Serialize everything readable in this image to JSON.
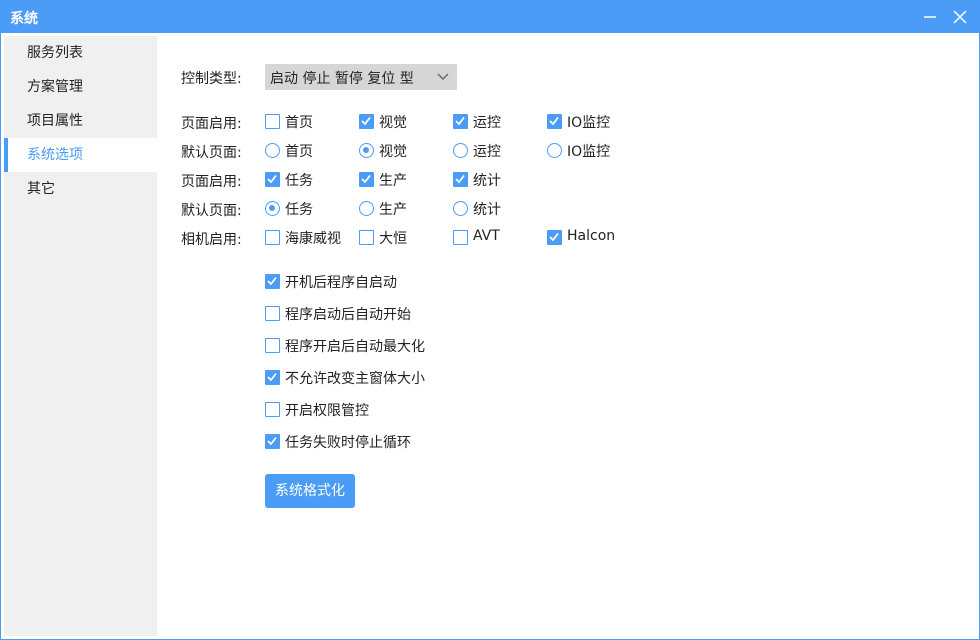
{
  "window": {
    "title": "系统"
  },
  "sidebar": {
    "items": [
      {
        "label": "服务列表",
        "active": false
      },
      {
        "label": "方案管理",
        "active": false
      },
      {
        "label": "项目属性",
        "active": false
      },
      {
        "label": "系统选项",
        "active": true
      },
      {
        "label": "其它",
        "active": false
      }
    ]
  },
  "control": {
    "label": "控制类型:",
    "value": "启动 停止 暂停 复位 型"
  },
  "rows": [
    {
      "label": "页面启用:",
      "type": "checkbox",
      "options": [
        {
          "label": "首页",
          "checked": false
        },
        {
          "label": "视觉",
          "checked": true
        },
        {
          "label": "运控",
          "checked": true
        },
        {
          "label": "IO监控",
          "checked": true
        }
      ]
    },
    {
      "label": "默认页面:",
      "type": "radio",
      "options": [
        {
          "label": "首页",
          "checked": false
        },
        {
          "label": "视觉",
          "checked": true
        },
        {
          "label": "运控",
          "checked": false
        },
        {
          "label": "IO监控",
          "checked": false
        }
      ]
    },
    {
      "label": "页面启用:",
      "type": "checkbox",
      "options": [
        {
          "label": "任务",
          "checked": true
        },
        {
          "label": "生产",
          "checked": true
        },
        {
          "label": "统计",
          "checked": true
        }
      ]
    },
    {
      "label": "默认页面:",
      "type": "radio",
      "options": [
        {
          "label": "任务",
          "checked": true
        },
        {
          "label": "生产",
          "checked": false
        },
        {
          "label": "统计",
          "checked": false
        }
      ]
    },
    {
      "label": "相机启用:",
      "type": "checkbox",
      "options": [
        {
          "label": "海康威视",
          "checked": false
        },
        {
          "label": "大恒",
          "checked": false
        },
        {
          "label": "AVT",
          "checked": false
        },
        {
          "label": "Halcon",
          "checked": true
        }
      ]
    }
  ],
  "options": [
    {
      "label": "开机后程序自启动",
      "checked": true
    },
    {
      "label": "程序启动后自动开始",
      "checked": false
    },
    {
      "label": "程序开启后自动最大化",
      "checked": false
    },
    {
      "label": "不允许改变主窗体大小",
      "checked": true
    },
    {
      "label": "开启权限管控",
      "checked": false
    },
    {
      "label": "任务失败时停止循环",
      "checked": true
    }
  ],
  "format_button": {
    "label": "系统格式化"
  },
  "colors": {
    "accent": "#4a9cf6",
    "sidebar_bg": "#f0f0f0",
    "select_bg": "#d6d6d6"
  },
  "icons": {
    "minimize": "minimize-icon",
    "close": "close-icon",
    "dropdown": "chevron-down-icon",
    "check": "checkmark-icon"
  }
}
